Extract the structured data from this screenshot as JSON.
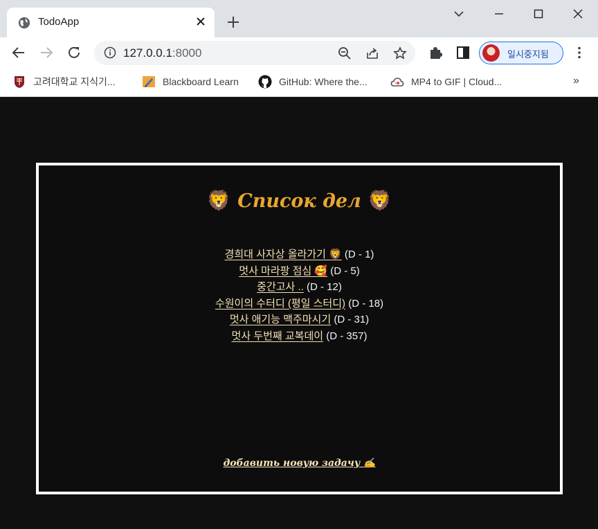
{
  "browser": {
    "tab_title": "TodoApp",
    "url_host": "127.0.0.1",
    "url_port": ":8000",
    "profile_label": "일시중지됨",
    "bookmarks": [
      {
        "label": "고려대학교 지식기...",
        "icon": "university-crest-icon"
      },
      {
        "label": "Blackboard Learn",
        "icon": "blackboard-pencil-icon"
      },
      {
        "label": "GitHub: Where the...",
        "icon": "github-icon"
      },
      {
        "label": "MP4 to GIF | Cloud...",
        "icon": "cloud-convert-icon"
      }
    ],
    "more_bookmarks": "»"
  },
  "page": {
    "heading_emoji": "🦁",
    "heading": "Список дел",
    "todos": [
      {
        "title": "경희대 사자상 올라가기 🦁",
        "dday": "(D - 1)"
      },
      {
        "title": "멋사 마라팡 점심 🥰",
        "dday": "(D - 5)"
      },
      {
        "title": "중간고사 ..",
        "dday": "(D - 12)"
      },
      {
        "title": "수원이의 수터디 (평일 스터디)",
        "dday": "(D - 18)"
      },
      {
        "title": "멋사 애기능 맥주마시기",
        "dday": "(D - 31)"
      },
      {
        "title": "멋사 두번째 교복데이",
        "dday": "(D - 357)"
      }
    ],
    "add_link": "добавить новую задачу ✍"
  },
  "colors": {
    "page_background": "#101010",
    "heading": "#e8a630",
    "todo_link": "#f4e1b4",
    "card_border": "#ffffff"
  }
}
